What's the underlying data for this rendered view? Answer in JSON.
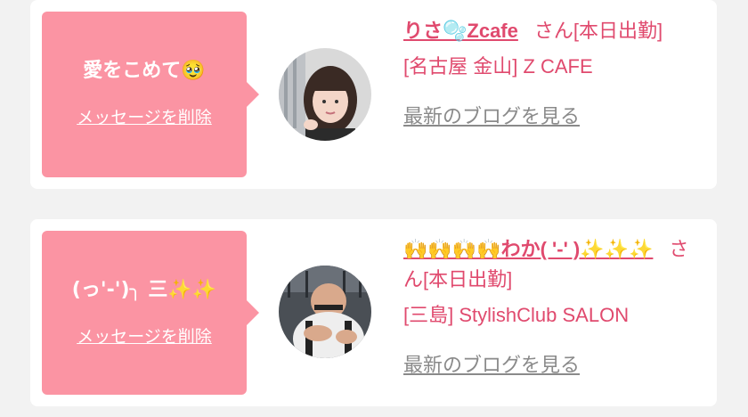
{
  "cards": [
    {
      "message": "愛をこめて🥹",
      "delete_label": "メッセージを削除",
      "name": "りさ🫧Zcafe",
      "san": "さん[本日出勤]",
      "location": "[名古屋 金山] Z CAFE",
      "blog_label": "最新のブログを見る"
    },
    {
      "message": "(っ'-')╮ 三✨✨",
      "delete_label": "メッセージを削除",
      "name": "🙌🙌🙌🙌わか( '-' )✨✨✨",
      "san": "さん[本日出勤]",
      "location": "[三島] StylishClub SALON",
      "blog_label": "最新のブログを見る"
    }
  ]
}
